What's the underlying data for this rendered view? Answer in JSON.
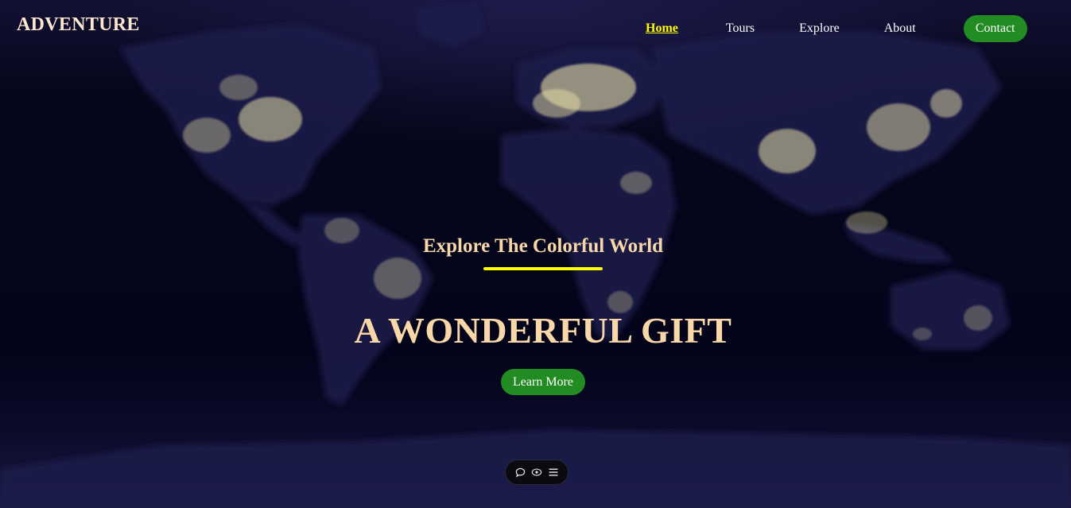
{
  "brand": {
    "logo_text": "ADVENTURE"
  },
  "nav": {
    "items": [
      {
        "label": "Home",
        "active": true
      },
      {
        "label": "Tours"
      },
      {
        "label": "Explore"
      },
      {
        "label": "About"
      }
    ],
    "contact_label": "Contact"
  },
  "hero": {
    "subtitle": "Explore The Colorful World",
    "headline": "A WONDERFUL GIFT",
    "cta_label": "Learn More",
    "background": "world-map-night-lights"
  },
  "toolbar": {
    "icons": [
      "comment-icon",
      "eye-icon",
      "menu-icon"
    ]
  },
  "colors": {
    "accent_yellow": "#ffff00",
    "button_green": "#228b22",
    "heading_peach": "#f8d8a8",
    "logo_cream": "#fde7d0",
    "background_navy": "#06061a"
  }
}
